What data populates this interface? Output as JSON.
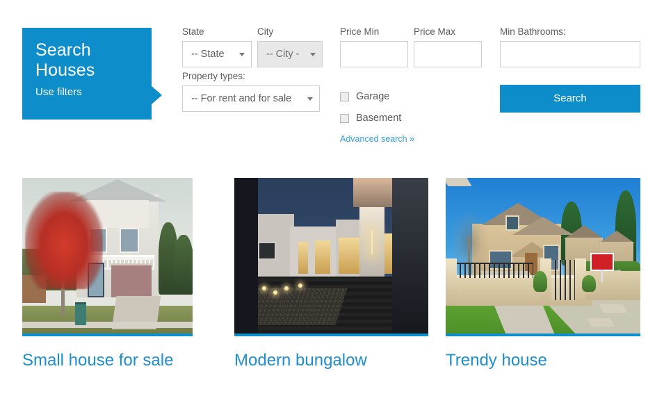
{
  "search_panel": {
    "title_line1": "Search",
    "title_line2": "Houses",
    "subtitle": "Use filters",
    "accent_color": "#0d8ecb"
  },
  "filters": {
    "state": {
      "label": "State",
      "value": "-- State",
      "disabled": false
    },
    "city": {
      "label": "City",
      "value": "-- City -",
      "disabled": true
    },
    "property_types": {
      "label": "Property types:",
      "value": "-- For rent and for sale"
    },
    "price_min": {
      "label": "Price Min",
      "value": "",
      "placeholder": ""
    },
    "price_max": {
      "label": "Price Max",
      "value": "",
      "placeholder": ""
    },
    "min_bathrooms": {
      "label": "Min Bathrooms:",
      "value": "",
      "placeholder": ""
    },
    "checkboxes": [
      {
        "label": "Garage",
        "checked": false
      },
      {
        "label": "Basement",
        "checked": false
      }
    ],
    "advanced_search_link": "Advanced search »",
    "search_button": "Search"
  },
  "listings": [
    {
      "title": "Small house for sale",
      "image_alt": "two-story suburban house with red maple tree and garage"
    },
    {
      "title": "Modern bungalow",
      "image_alt": "modern flat-roof bungalow at dusk with lit windows and decking"
    },
    {
      "title": "Trendy house",
      "image_alt": "large suburban house with stone fence, lawn and for-sale sign"
    }
  ]
}
